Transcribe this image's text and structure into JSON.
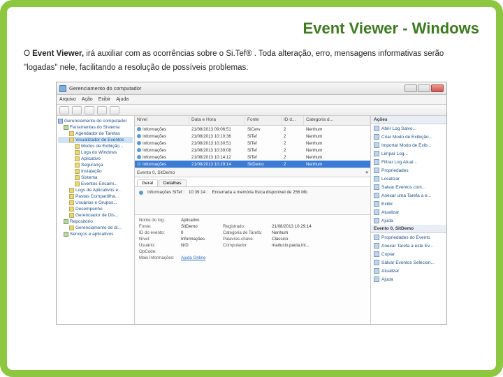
{
  "slide": {
    "title": "Event Viewer - Windows",
    "desc_prefix": "O ",
    "desc_bold": "Event Viewer,",
    "desc_rest": " irá auxiliar com as ocorrências sobre o Si.Tef® . Toda alteração, erro, mensagens informativas serão \"logadas\" nele, facilitando a resolução de possíveis problemas."
  },
  "window": {
    "title": "Gerenciamento do computador",
    "menu": [
      "Arquivo",
      "Ação",
      "Exibir",
      "Ajuda"
    ]
  },
  "tree": [
    {
      "lvl": 0,
      "icon": "blue",
      "label": "Gerenciamento do computador"
    },
    {
      "lvl": 1,
      "icon": "gr",
      "label": "Ferramentas do Sistema"
    },
    {
      "lvl": 2,
      "icon": "",
      "label": "Agendador de Tarefas"
    },
    {
      "lvl": 2,
      "icon": "",
      "label": "Visualizador de Eventos",
      "sel": true
    },
    {
      "lvl": 3,
      "icon": "",
      "label": "Modos de Exibição..."
    },
    {
      "lvl": 3,
      "icon": "",
      "label": "Logs do Windows"
    },
    {
      "lvl": 3,
      "icon": "",
      "label": "Aplicativo"
    },
    {
      "lvl": 3,
      "icon": "",
      "label": "Segurança"
    },
    {
      "lvl": 3,
      "icon": "",
      "label": "Instalação"
    },
    {
      "lvl": 3,
      "icon": "",
      "label": "Sistema"
    },
    {
      "lvl": 3,
      "icon": "",
      "label": "Eventos Encami..."
    },
    {
      "lvl": 2,
      "icon": "",
      "label": "Logs de Aplicativos e..."
    },
    {
      "lvl": 2,
      "icon": "",
      "label": "Pastas Compartilha..."
    },
    {
      "lvl": 2,
      "icon": "",
      "label": "Usuários e Grupos..."
    },
    {
      "lvl": 2,
      "icon": "",
      "label": "Desempenho"
    },
    {
      "lvl": 2,
      "icon": "",
      "label": "Gerenciador de Dis..."
    },
    {
      "lvl": 1,
      "icon": "gr",
      "label": "Repositório"
    },
    {
      "lvl": 2,
      "icon": "",
      "label": "Gerenciamento de di..."
    },
    {
      "lvl": 1,
      "icon": "gr",
      "label": "Serviços e aplicativos"
    }
  ],
  "grid": {
    "headers": [
      "Nível",
      "Data e Hora",
      "Fonte",
      "ID d...",
      "Categoria d..."
    ],
    "rows": [
      {
        "level": "Informações",
        "dt": "21/08/2013 09:06:51",
        "src": "SiCerv",
        "id": "2",
        "cat": "Nenhum"
      },
      {
        "level": "Informações",
        "dt": "21/08/2013 10:10:36",
        "src": "SiTef",
        "id": "2",
        "cat": "Nenhum"
      },
      {
        "level": "Informações",
        "dt": "21/08/2013 10:30:51",
        "src": "SiTef",
        "id": "2",
        "cat": "Nenhum"
      },
      {
        "level": "Informações",
        "dt": "21/08/2013 10:39:08",
        "src": "SiTef",
        "id": "2",
        "cat": "Nenhum"
      },
      {
        "level": "Informações",
        "dt": "21/08/2013 10:14:12",
        "src": "SiTef",
        "id": "2",
        "cat": "Nenhum"
      },
      {
        "level": "Informações",
        "dt": "21/08/2013 10:29:14",
        "src": "SitDemo",
        "id": "2",
        "cat": "Nenhum",
        "sel": true
      }
    ]
  },
  "detail": {
    "event_title": "Evento 0, SitDemo",
    "tabs": [
      "Geral",
      "Detalhes"
    ],
    "msg_label": "Informações SiTef :",
    "msg_time": "10:39:14 :",
    "msg_text": "Encerrada a memória física disponível de 256 Mb"
  },
  "props": {
    "rows": [
      [
        "Nome do log:",
        "Aplicativo",
        "",
        ""
      ],
      [
        "Fonte:",
        "SitDemo",
        "Registrado:",
        "21/08/2013 10:29:14"
      ],
      [
        "ID do evento:",
        "0",
        "Categoria de Tarefa:",
        "Nenhum"
      ],
      [
        "Nível:",
        "Informações",
        "Palavras-chave:",
        "Clássico"
      ],
      [
        "Usuário:",
        "N/D",
        "Computador:",
        "marlucio.paula.int..."
      ]
    ],
    "opcode": "OpCode:",
    "more_label": "Mais Informações:",
    "more_link": "Ajuda Online"
  },
  "actions": {
    "header1": "Ações",
    "group1": [
      "Abrir Log Salvo...",
      "Criar Modo de Exibição...",
      "Importar Modo de Exib...",
      "Limpar Log...",
      "Filtrar Log Atual...",
      "Propriedades",
      "Localizar",
      "Salvar Eventos com...",
      "Anexar uma Tarefa a e...",
      "Exibir",
      "Atualizar",
      "Ajuda"
    ],
    "header2": "Evento 0, SitDemo",
    "group2": [
      "Propriedades do Evento",
      "Anexar Tarefa a este Ev...",
      "Copiar",
      "Salvar Eventos Selecion...",
      "Atualizar",
      "Ajuda"
    ]
  }
}
